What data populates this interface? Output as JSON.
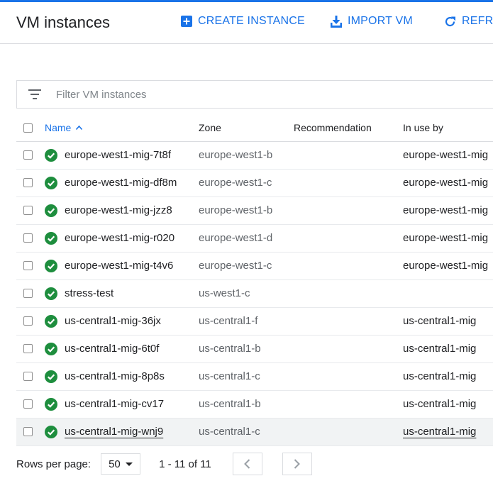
{
  "header": {
    "title": "VM instances",
    "create_label": "CREATE INSTANCE",
    "import_label": "IMPORT VM",
    "refresh_label": "REFRESH"
  },
  "filter": {
    "placeholder": "Filter VM instances"
  },
  "table": {
    "columns": [
      "Name",
      "Zone",
      "Recommendation",
      "In use by"
    ],
    "rows": [
      {
        "name": "europe-west1-mig-7t8f",
        "zone": "europe-west1-b",
        "recommendation": "",
        "in_use_by": "europe-west1-mig"
      },
      {
        "name": "europe-west1-mig-df8m",
        "zone": "europe-west1-c",
        "recommendation": "",
        "in_use_by": "europe-west1-mig"
      },
      {
        "name": "europe-west1-mig-jzz8",
        "zone": "europe-west1-b",
        "recommendation": "",
        "in_use_by": "europe-west1-mig"
      },
      {
        "name": "europe-west1-mig-r020",
        "zone": "europe-west1-d",
        "recommendation": "",
        "in_use_by": "europe-west1-mig"
      },
      {
        "name": "europe-west1-mig-t4v6",
        "zone": "europe-west1-c",
        "recommendation": "",
        "in_use_by": "europe-west1-mig"
      },
      {
        "name": "stress-test",
        "zone": "us-west1-c",
        "recommendation": "",
        "in_use_by": ""
      },
      {
        "name": "us-central1-mig-36jx",
        "zone": "us-central1-f",
        "recommendation": "",
        "in_use_by": "us-central1-mig"
      },
      {
        "name": "us-central1-mig-6t0f",
        "zone": "us-central1-b",
        "recommendation": "",
        "in_use_by": "us-central1-mig"
      },
      {
        "name": "us-central1-mig-8p8s",
        "zone": "us-central1-c",
        "recommendation": "",
        "in_use_by": "us-central1-mig"
      },
      {
        "name": "us-central1-mig-cv17",
        "zone": "us-central1-b",
        "recommendation": "",
        "in_use_by": "us-central1-mig"
      },
      {
        "name": "us-central1-mig-wnj9",
        "zone": "us-central1-c",
        "recommendation": "",
        "in_use_by": "us-central1-mig"
      }
    ]
  },
  "pagination": {
    "rows_per_page_label": "Rows per page:",
    "rows_per_page_value": "50",
    "range_text": "1 - 11 of 11"
  },
  "colors": {
    "accent": "#1a73e8",
    "status_ok": "#1e8e3e",
    "border": "#dadce0",
    "row_hover": "#f1f3f4"
  },
  "icons": {
    "create": "add-box-icon",
    "import": "download-icon",
    "refresh": "refresh-icon",
    "filter": "filter-list-icon",
    "sort": "arrow-up-icon",
    "status": "check-circle-icon",
    "select": "dropdown-caret-icon",
    "prev": "chevron-left-icon",
    "next": "chevron-right-icon"
  }
}
